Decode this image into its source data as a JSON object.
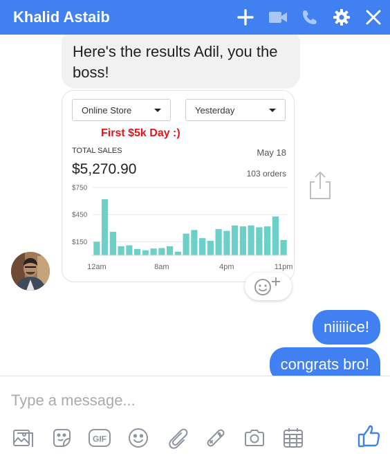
{
  "header": {
    "title": "Khalid Astaib",
    "bg_color": "#4080f0",
    "icons": [
      "plus-icon",
      "video-camera-icon",
      "phone-icon",
      "gear-icon",
      "close-icon"
    ]
  },
  "messages": {
    "incoming_text": "Here's the results Adil, you the boss!",
    "outgoing": [
      "niiiiice!",
      "congrats bro!"
    ]
  },
  "shopify_card": {
    "store_select": "Online Store",
    "period_select": "Yesterday",
    "annotation": "First $5k Day :)",
    "total_sales_label": "TOTAL SALES",
    "date": "May 18",
    "total_sales_value": "$5,270.90",
    "orders": "103 orders"
  },
  "chart_data": {
    "type": "bar",
    "title": "",
    "xlabel": "",
    "ylabel": "",
    "y_ticks": [
      "$750",
      "$450",
      "$150"
    ],
    "x_ticks": [
      "12am",
      "8am",
      "4pm",
      "11pm"
    ],
    "ylim": [
      0,
      750
    ],
    "grid": true,
    "bar_color": "#6ccfc8",
    "values": [
      150,
      620,
      260,
      100,
      110,
      70,
      55,
      75,
      80,
      100,
      40,
      240,
      280,
      190,
      160,
      290,
      270,
      330,
      320,
      330,
      310,
      320,
      430,
      170
    ]
  },
  "composer": {
    "placeholder": "Type a message...",
    "tools": [
      "image-icon",
      "sticker-icon",
      "gif-icon",
      "emoji-icon",
      "paperclip-icon",
      "game-controller-icon",
      "camera-icon",
      "calendar-icon"
    ],
    "like_icon": "thumbs-up-icon"
  }
}
